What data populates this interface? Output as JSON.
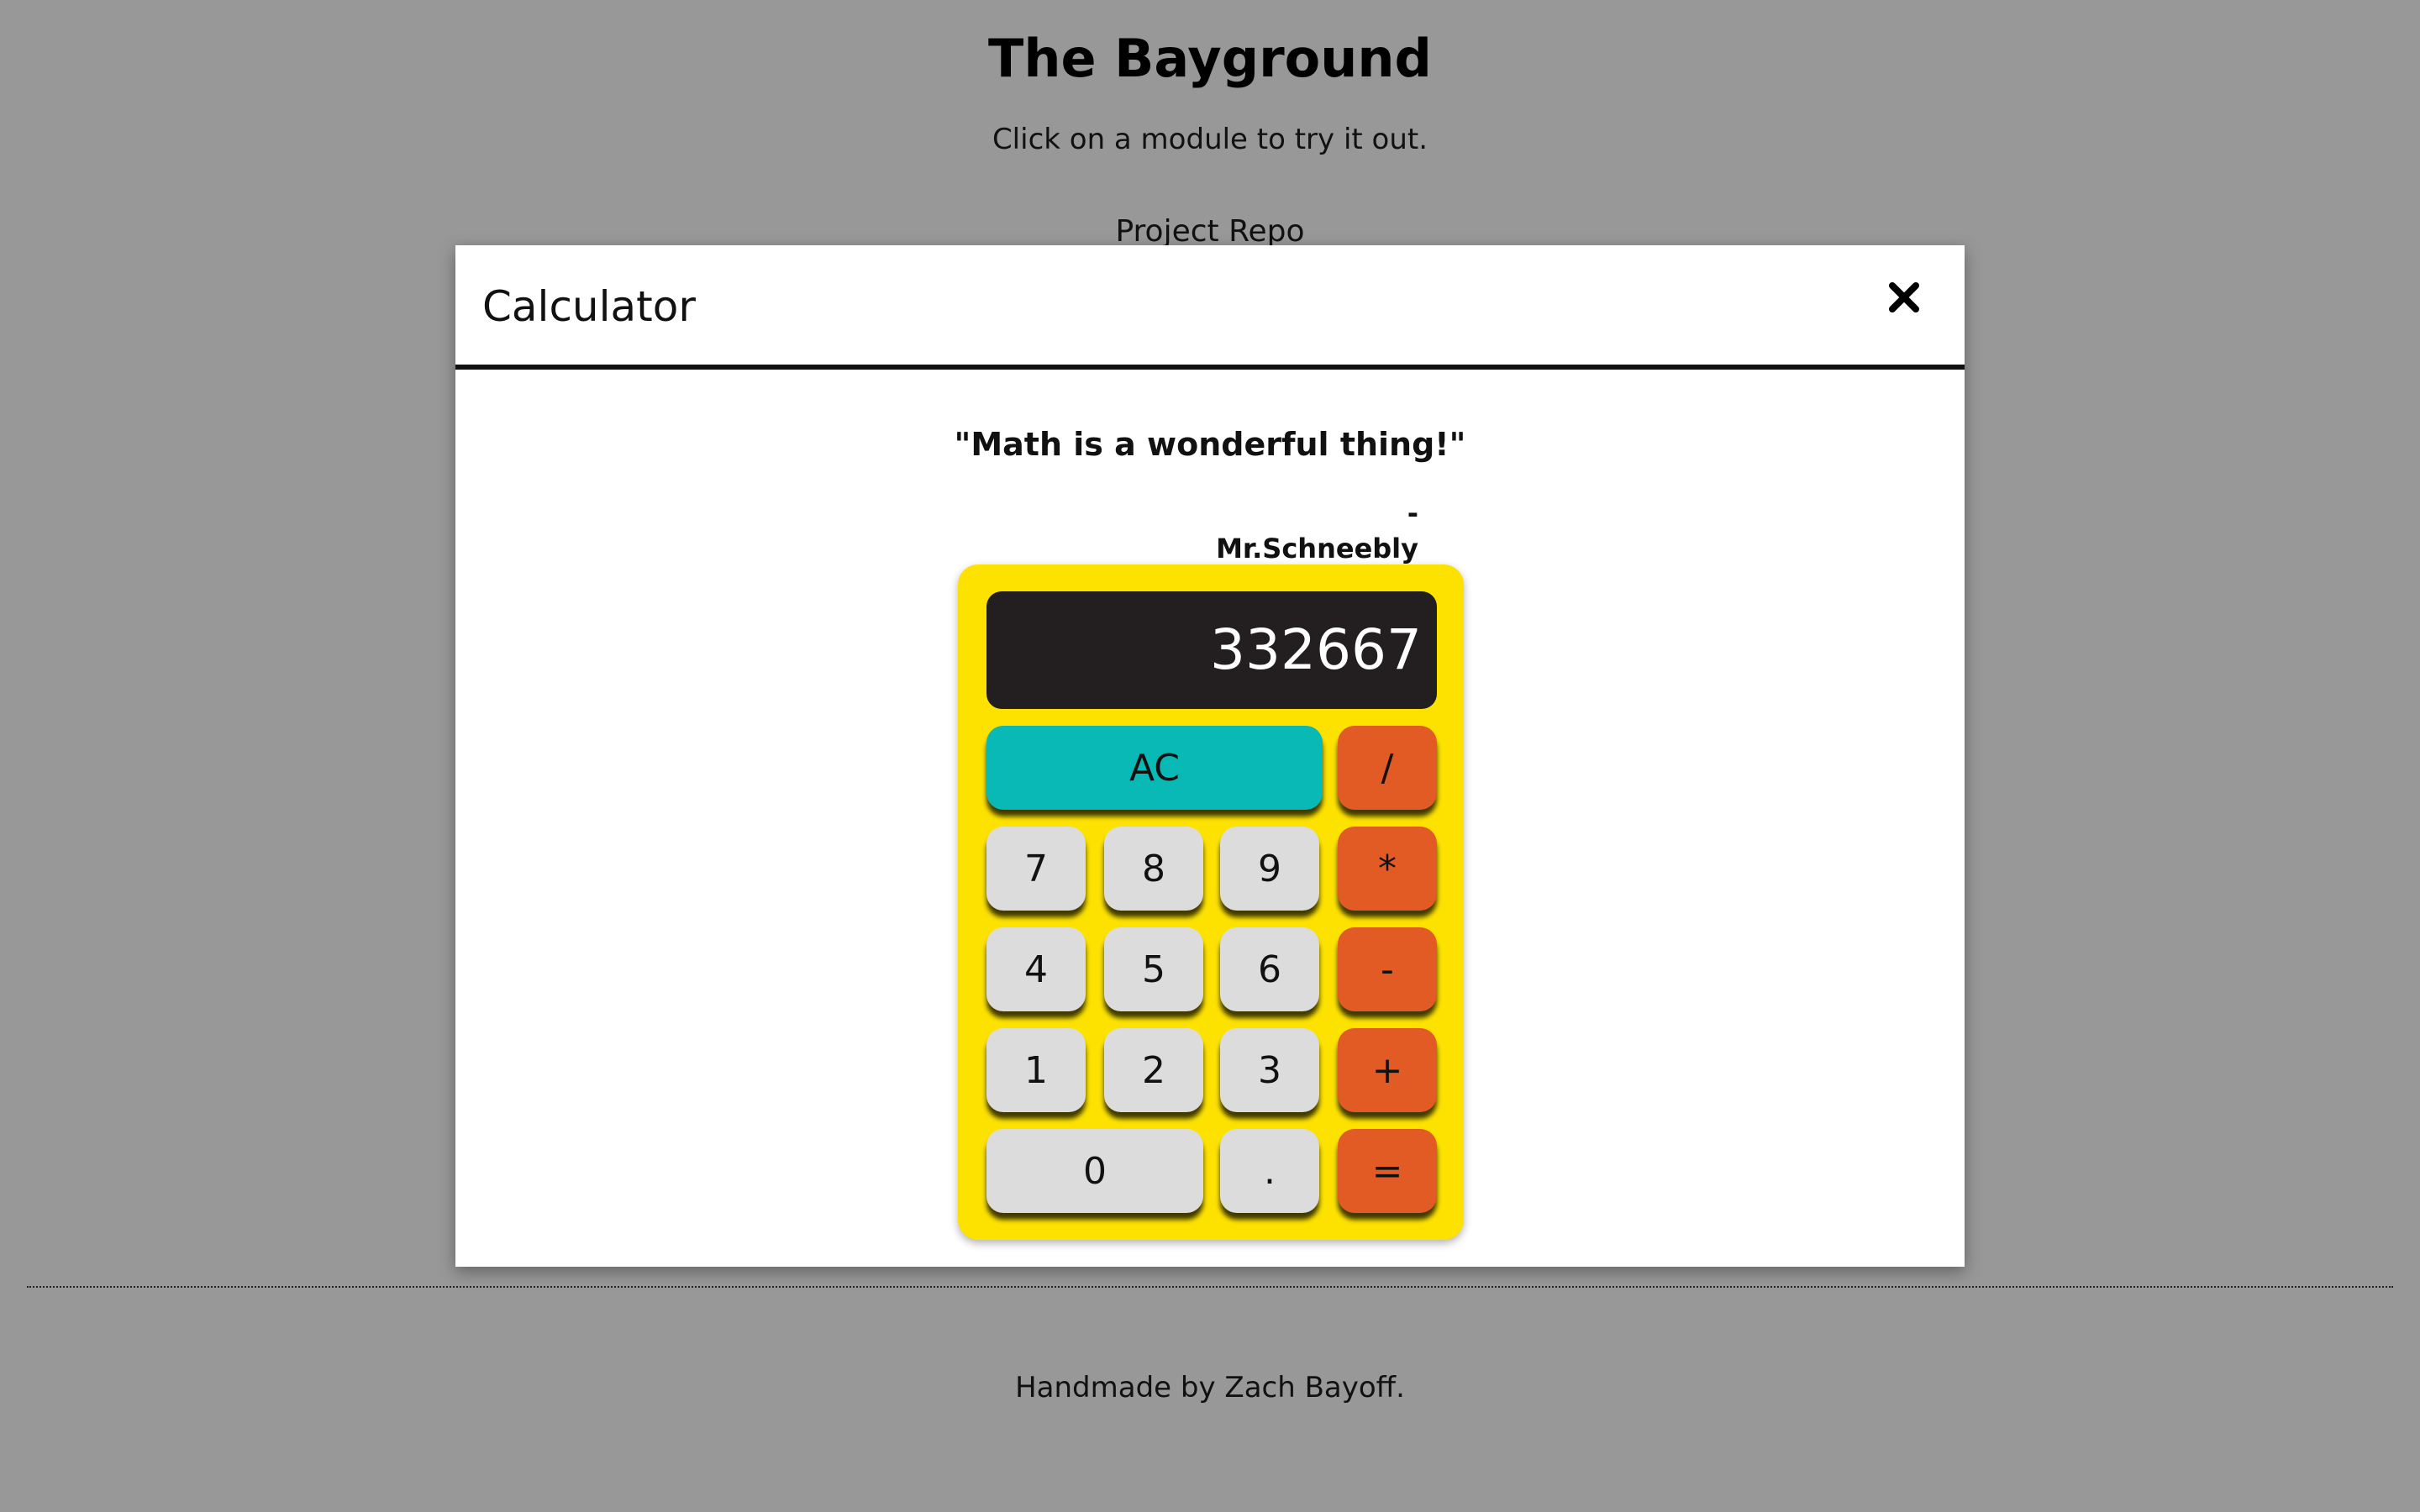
{
  "page": {
    "title": "The Bayground",
    "subtitle": "Click on a module to try it out.",
    "project_link": "Project Repo",
    "footer": "Handmade by Zach Bayoff."
  },
  "modal": {
    "title": "Calculator",
    "close_icon": "close-x-icon",
    "quote": "\"Math is a wonderful thing!\"",
    "quote_author": "- Mr.Schneebly"
  },
  "calculator": {
    "display": "332667",
    "keys": {
      "clear": "AC",
      "divide": "/",
      "seven": "7",
      "eight": "8",
      "nine": "9",
      "multiply": "*",
      "four": "4",
      "five": "5",
      "six": "6",
      "subtract": "-",
      "one": "1",
      "two": "2",
      "three": "3",
      "add": "+",
      "zero": "0",
      "decimal": ".",
      "equals": "="
    }
  },
  "colors": {
    "background": "#989898",
    "calculator_body": "#fde200",
    "display_bg": "#231f20",
    "number_key": "#dcdcdc",
    "operator_key": "#e25a24",
    "clear_key": "#08b9b6"
  }
}
